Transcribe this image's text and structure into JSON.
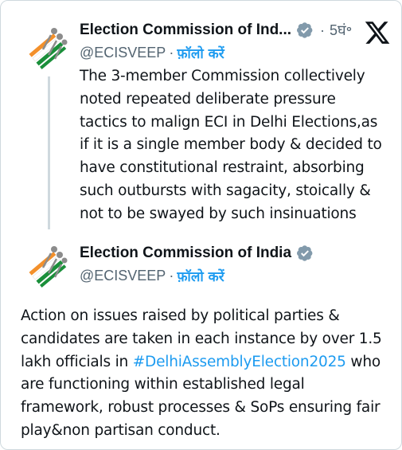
{
  "colors": {
    "accent": "#1d9bf0",
    "text": "#0f1419",
    "secondary": "#536471",
    "border": "#cfd9de",
    "logo_saffron": "#f3902b",
    "logo_green": "#1a8f3a",
    "logo_grey": "#8c8c8c"
  },
  "header": {
    "x_logo_icon": "x-logo-icon"
  },
  "tweets": [
    {
      "display_name": "Election Commission of Ind...",
      "verified_icon": "verified-badge-icon",
      "separator": "·",
      "time": "5घं॰",
      "handle": "@ECISVEEP",
      "follow_label": "फ़ॉलो करें",
      "body_lines": [
        "The 3-member Commission collectively",
        "noted repeated deliberate pressure",
        "tactics to malign ECI in Delhi Elections,as",
        "if it is a single member body & decided to",
        "have constitutional restraint, absorbing",
        "such outbursts with sagacity, stoically &",
        "not to be swayed by such insinuations"
      ]
    },
    {
      "display_name": "Election Commission of India",
      "verified_icon": "verified-badge-icon",
      "separator": "·",
      "handle": "@ECISVEEP",
      "follow_label": "फ़ॉलो करें",
      "body": {
        "line1": "Action on issues raised by political parties &",
        "line2": "candidates are taken in each instance by over 1.5",
        "line3_prefix": "lakh officials in ",
        "hashtag": "#DelhiAssemblyElection2025",
        "line3_suffix": " who",
        "line4": "are functioning within established legal",
        "line5": "framework, robust processes & SoPs ensuring fair",
        "line6": "play&non partisan conduct."
      }
    }
  ]
}
